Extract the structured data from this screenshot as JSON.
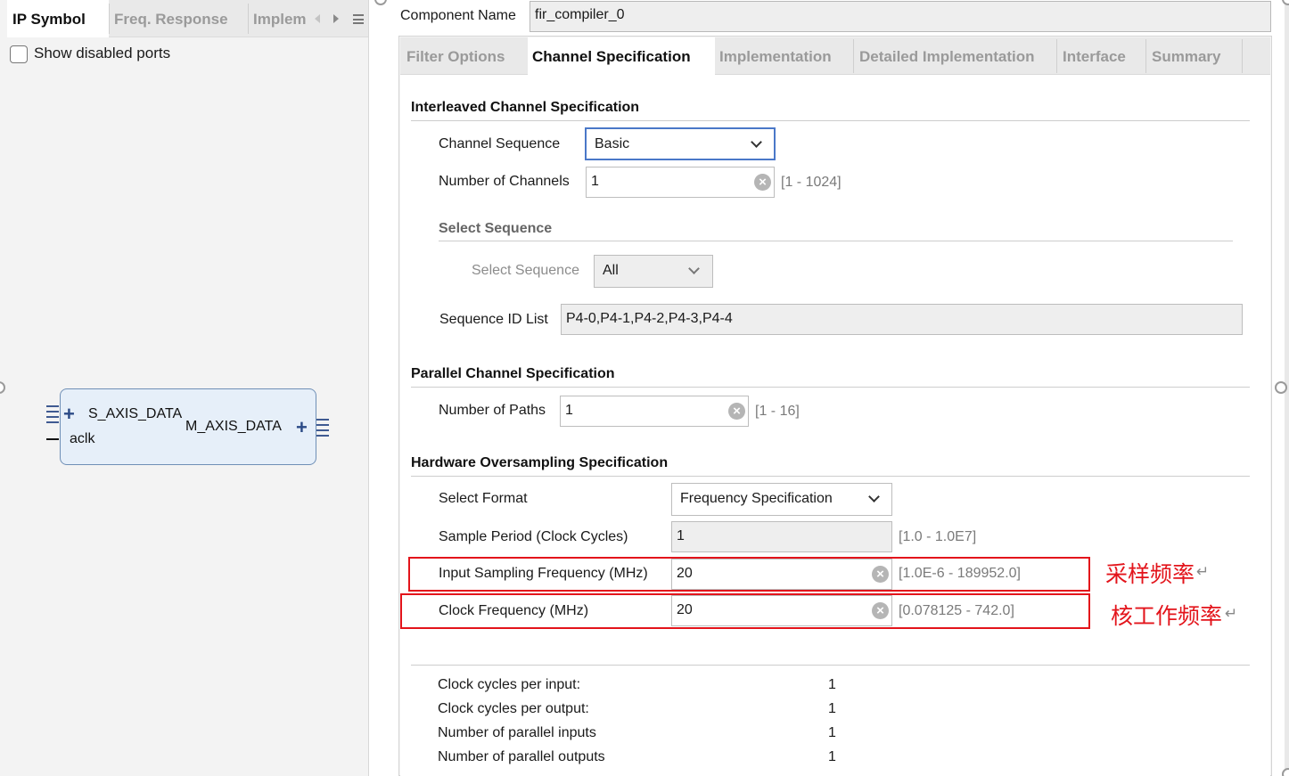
{
  "left": {
    "tabs": [
      {
        "label": "IP Symbol"
      },
      {
        "label": "Freq. Response"
      },
      {
        "label": "Implem"
      }
    ],
    "show_disabled_ports_label": "Show disabled ports",
    "show_disabled_ports_checked": false,
    "symbol": {
      "port_in": "S_AXIS_DATA",
      "port_clk": "aclk",
      "port_out": "M_AXIS_DATA"
    }
  },
  "component": {
    "label": "Component Name",
    "value": "fir_compiler_0"
  },
  "tabs": [
    {
      "label": "Filter Options"
    },
    {
      "label": "Channel Specification"
    },
    {
      "label": "Implementation"
    },
    {
      "label": "Detailed Implementation"
    },
    {
      "label": "Interface"
    },
    {
      "label": "Summary"
    }
  ],
  "active_tab": "Channel Specification",
  "interleaved": {
    "title": "Interleaved Channel Specification",
    "channel_sequence_label": "Channel Sequence",
    "channel_sequence_value": "Basic",
    "num_channels_label": "Number of Channels",
    "num_channels_value": "1",
    "num_channels_range": "[1 - 1024]",
    "select_sequence_title": "Select Sequence",
    "select_sequence_label": "Select Sequence",
    "select_sequence_value": "All",
    "sequence_id_label": "Sequence ID List",
    "sequence_id_value": "P4-0,P4-1,P4-2,P4-3,P4-4"
  },
  "parallel": {
    "title": "Parallel Channel Specification",
    "num_paths_label": "Number of Paths",
    "num_paths_value": "1",
    "num_paths_range": "[1 - 16]"
  },
  "oversampling": {
    "title": "Hardware Oversampling Specification",
    "select_format_label": "Select Format",
    "select_format_value": "Frequency Specification",
    "sample_period_label": "Sample Period (Clock Cycles)",
    "sample_period_value": "1",
    "sample_period_range": "[1.0 - 1.0E7]",
    "input_freq_label": "Input Sampling Frequency (MHz)",
    "input_freq_value": "20",
    "input_freq_range": "[1.0E-6 - 189952.0]",
    "clock_freq_label": "Clock Frequency (MHz)",
    "clock_freq_value": "20",
    "clock_freq_range": "[0.078125 - 742.0]"
  },
  "annotations": {
    "input_freq_note": "采样频率",
    "clock_freq_note": "核工作频率",
    "return_mark": "↵"
  },
  "summary": {
    "rows": [
      {
        "label": "Clock cycles per input:",
        "value": "1"
      },
      {
        "label": "Clock cycles per output:",
        "value": "1"
      },
      {
        "label": "Number of parallel inputs",
        "value": "1"
      },
      {
        "label": "Number of parallel outputs",
        "value": "1"
      }
    ]
  },
  "colors": {
    "focus_border": "#4a78c8",
    "annotation_red": "#e3141b",
    "symbol_fill": "#e6eff9",
    "symbol_border": "#6f8fb6"
  }
}
